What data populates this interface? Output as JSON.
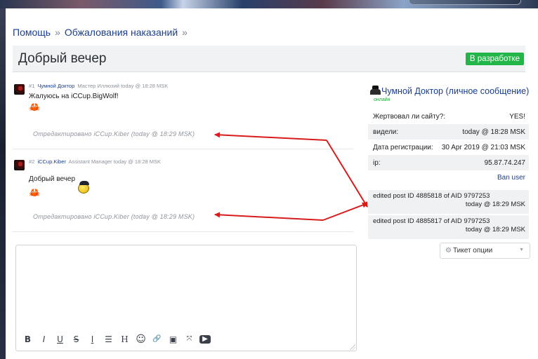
{
  "breadcrumb": {
    "items": [
      "Помощь",
      "Обжалования наказаний"
    ],
    "separator": "»",
    "trailing": "»"
  },
  "title": "Добрый вечер",
  "status_badge": "В разработке",
  "posts": [
    {
      "num": "#1",
      "author": "Чумной Доктор",
      "rank": "Мастер Иллюзий",
      "time": "today @ 18:28 MSK",
      "text": "Жалуюсь на iCCup.BigWolf!",
      "edited": "Отредактировано iCCup.Kiber (today @ 18:29 MSK)"
    },
    {
      "num": "#2",
      "author": "iCCup.Kiber",
      "rank": "Assistant Manager",
      "time": "today @ 18:28 MSK",
      "text": "Добрый вечер",
      "edited": "Отредактировано iCCup.Kiber (today @ 18:29 MSK)"
    }
  ],
  "sidebar": {
    "name": "Чумной Доктор",
    "pm_link": "(личное сообщение)",
    "online": "онлайн",
    "rows": [
      {
        "label": "Жертвовал ли сайту?:",
        "value": "YES!"
      },
      {
        "label": "видели:",
        "value": "today @ 18:28 MSK"
      },
      {
        "label": "Дата регистрации:",
        "value": "30 Apr 2019 @ 21:03 MSK"
      },
      {
        "label": "ip:",
        "value": "95.87.74.247"
      }
    ],
    "ban": "Ban user",
    "logs": [
      {
        "text": "edited post ID 4885818 of AID 9797253",
        "time": "today @ 18:29 MSK"
      },
      {
        "text": "edited post ID 4885817 of AID 9797253",
        "time": "today @ 18:29 MSK"
      }
    ],
    "ticket_options": "Тикет опции"
  },
  "editor": {
    "toolbar_icons": [
      "bold-icon",
      "italic-icon",
      "underline-icon",
      "strikethrough-icon",
      "text-format-icon",
      "list-icon",
      "heading-icon",
      "emoji-icon",
      "link-icon",
      "image-icon",
      "collapse-icon",
      "video-icon"
    ],
    "toolbar_glyphs": [
      "B",
      "I",
      "U",
      "S",
      "I",
      "☰",
      "H",
      "☺",
      "🔗",
      "▣",
      "⤧",
      "▶"
    ]
  },
  "colors": {
    "link": "#1a3e8c",
    "badge": "#22b548",
    "arrow": "#d81c1c"
  }
}
